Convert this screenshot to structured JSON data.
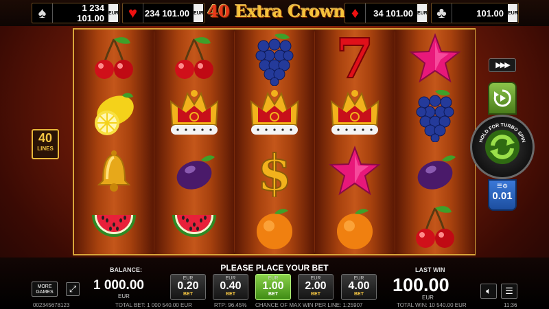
{
  "jackpots": [
    {
      "suit": "spade",
      "glyph": "♠",
      "color": "#dddddd",
      "value": "1 234 101.00",
      "currency": "EUR"
    },
    {
      "suit": "heart",
      "glyph": "♥",
      "color": "#e11111",
      "value": "234 101.00",
      "currency": "EUR"
    },
    {
      "suit": "diamond",
      "glyph": "♦",
      "color": "#e11111",
      "value": "34 101.00",
      "currency": "EUR"
    },
    {
      "suit": "club",
      "glyph": "♣",
      "color": "#dddddd",
      "value": "101.00",
      "currency": "EUR"
    }
  ],
  "logo": {
    "number": "40",
    "name": "Extra Crown"
  },
  "reels": [
    [
      "cherry-icon",
      "lemon-icon",
      "bell-icon",
      "watermelon-icon"
    ],
    [
      "cherry-icon",
      "crown-icon",
      "plum-icon",
      "watermelon-icon"
    ],
    [
      "grapes-icon",
      "crown-icon",
      "dollar-icon",
      "orange-icon"
    ],
    [
      "seven-icon",
      "crown-icon",
      "star-icon",
      "orange-icon"
    ],
    [
      "star-icon",
      "grapes-icon",
      "plum-icon",
      "cherry-icon"
    ]
  ],
  "lines": {
    "count": "40",
    "label": "LINES"
  },
  "autoplay": {
    "label": "▶▶▶"
  },
  "spin": {
    "label": "HOLD FOR TURBO SPIN"
  },
  "gamble": {
    "value": "0.01"
  },
  "bottom": {
    "balance_label": "BALANCE:",
    "balance_value": "1 000.00",
    "balance_currency": "EUR",
    "prompt": "PLEASE PLACE YOUR BET",
    "last_win_label": "LAST WIN",
    "last_win_value": "100.00",
    "last_win_currency": "EUR",
    "more_games": "MORE GAMES",
    "bets": [
      {
        "currency": "EUR",
        "amount": "0.20",
        "label": "BET",
        "selected": false
      },
      {
        "currency": "EUR",
        "amount": "0.40",
        "label": "BET",
        "selected": false
      },
      {
        "currency": "EUR",
        "amount": "1.00",
        "label": "BET",
        "selected": true
      },
      {
        "currency": "EUR",
        "amount": "2.00",
        "label": "BET",
        "selected": false
      },
      {
        "currency": "EUR",
        "amount": "4.00",
        "label": "BET",
        "selected": false
      }
    ]
  },
  "footer": {
    "session_id": "002345678123",
    "total_bet": "TOTAL BET: 1 000 540.00 EUR",
    "rtp": "RTP: 96.45%",
    "chance": "CHANCE OF MAX WIN PER LINE: 1:25907",
    "total_win": "TOTAL WIN: 10 540.00 EUR",
    "time": "11:36"
  }
}
